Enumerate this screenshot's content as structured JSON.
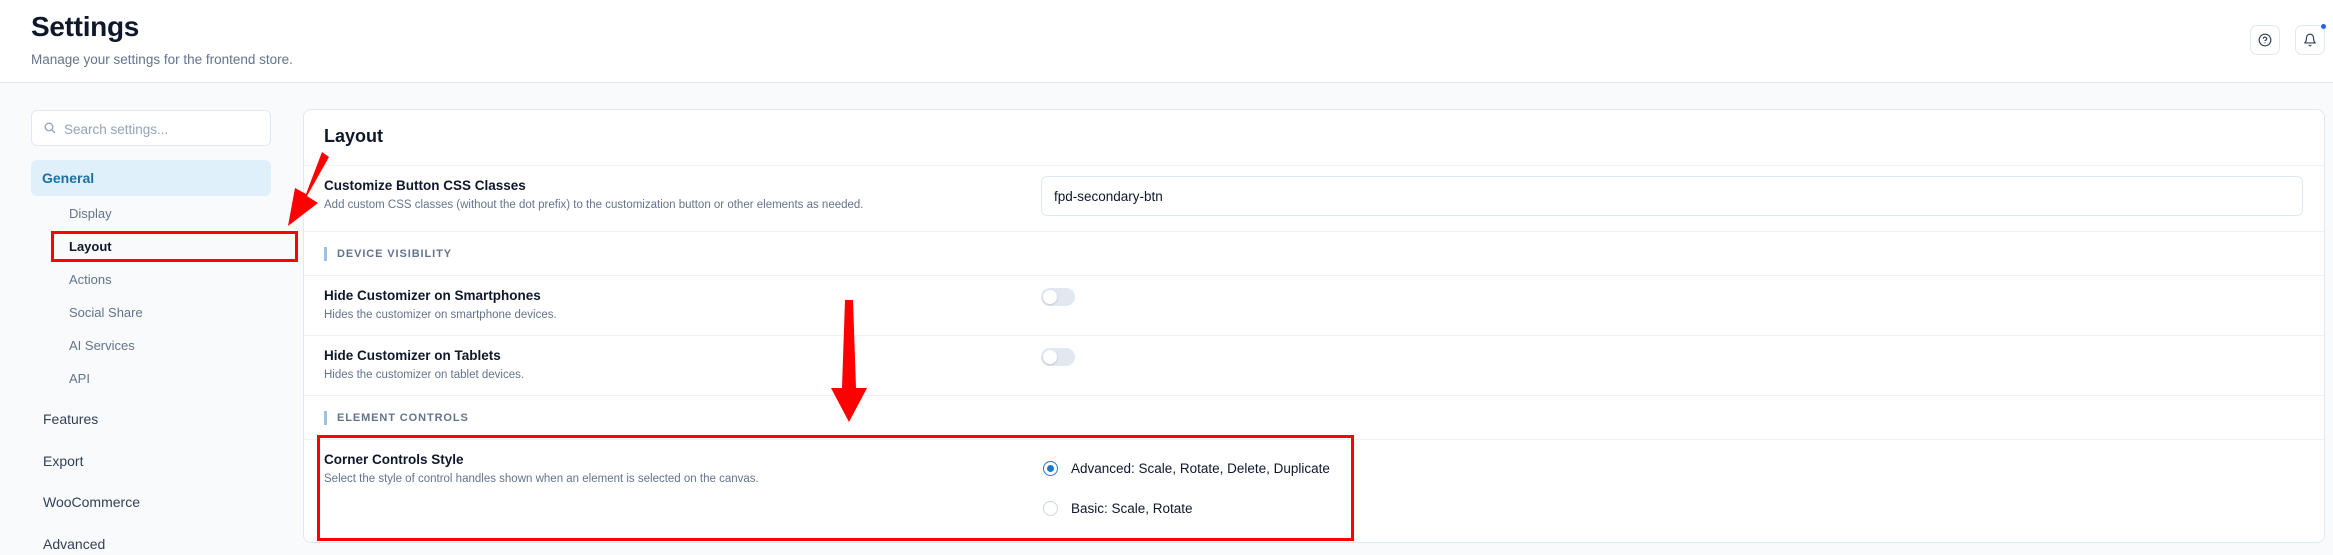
{
  "header": {
    "title": "Settings",
    "subtitle": "Manage your settings for the frontend store.",
    "help_icon": "help-circle-icon",
    "bell_icon": "bell-icon"
  },
  "sidebar": {
    "search_placeholder": "Search settings...",
    "general": "General",
    "sub_items": [
      "Display",
      "Layout",
      "Actions",
      "Social Share",
      "AI Services",
      "API"
    ],
    "active_sub_item": "Layout",
    "main_items": [
      "Features",
      "Export",
      "WooCommerce",
      "Advanced"
    ]
  },
  "content": {
    "title": "Layout",
    "css_classes": {
      "label": "Customize Button CSS Classes",
      "description": "Add custom CSS classes (without the dot prefix) to the customization button or other elements as needed.",
      "value": "fpd-secondary-btn"
    },
    "device_visibility": {
      "section_label": "DEVICE VISIBILITY",
      "smartphones": {
        "label": "Hide Customizer on Smartphones",
        "description": "Hides the customizer on smartphone devices.",
        "enabled": false
      },
      "tablets": {
        "label": "Hide Customizer on Tablets",
        "description": "Hides the customizer on tablet devices.",
        "enabled": false
      }
    },
    "element_controls": {
      "section_label": "ELEMENT CONTROLS",
      "corner_style": {
        "label": "Corner Controls Style",
        "description": "Select the style of control handles shown when an element is selected on the canvas.",
        "options": [
          "Advanced: Scale, Rotate, Delete, Duplicate",
          "Basic: Scale, Rotate"
        ],
        "selected": "Advanced: Scale, Rotate, Delete, Duplicate"
      }
    }
  },
  "colors": {
    "accent": "#1a7bc4",
    "annotation": "#ff0000",
    "active_nav_bg": "#e0f0fb"
  }
}
